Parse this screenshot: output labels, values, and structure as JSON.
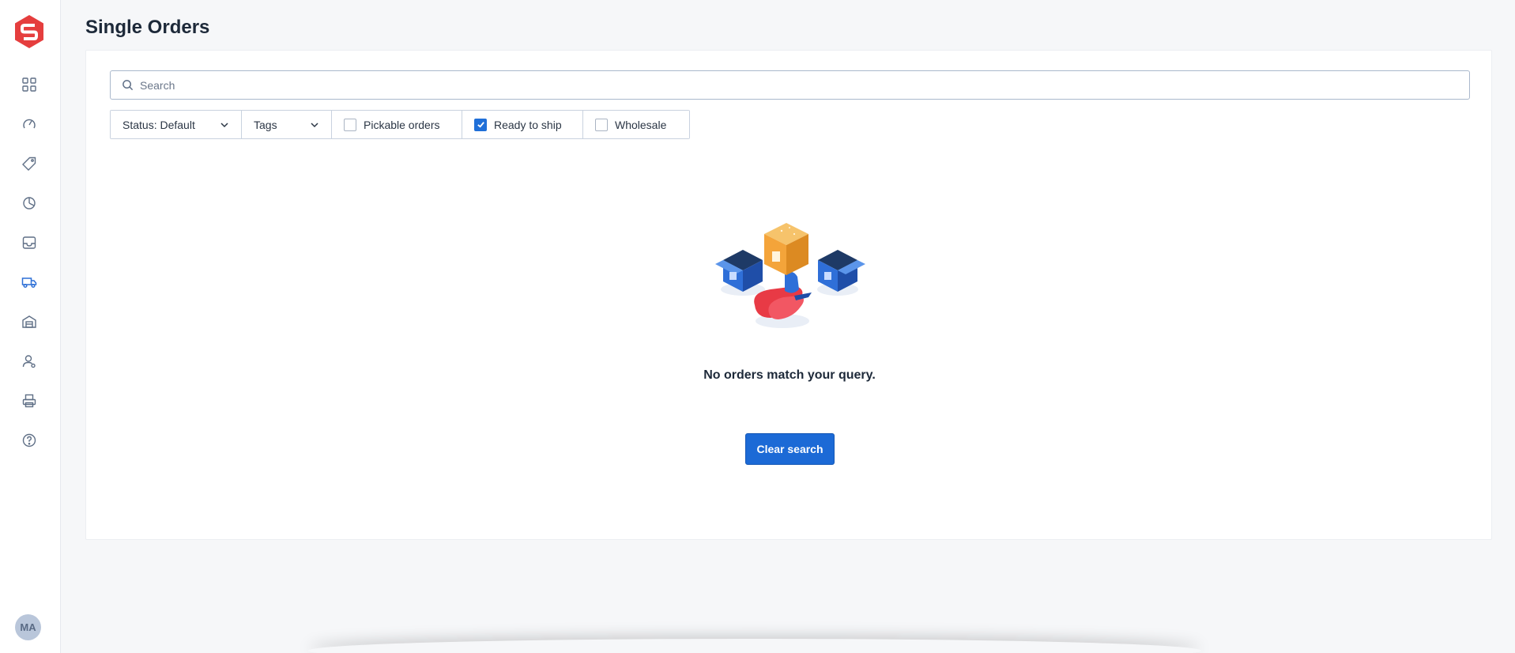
{
  "page": {
    "title": "Single Orders"
  },
  "sidebar": {
    "logo": "shipstation-s-logo",
    "brand_color": "#e53e3e",
    "items": [
      {
        "icon": "dashboard-grid-icon"
      },
      {
        "icon": "speedometer-icon"
      },
      {
        "icon": "tag-icon"
      },
      {
        "icon": "pie-chart-icon"
      },
      {
        "icon": "inbox-icon"
      },
      {
        "icon": "truck-icon",
        "active": true
      },
      {
        "icon": "warehouse-icon"
      },
      {
        "icon": "customers-icon"
      },
      {
        "icon": "printer-icon"
      },
      {
        "icon": "help-icon"
      }
    ],
    "avatar_initials": "MA"
  },
  "search": {
    "placeholder": "Search",
    "value": ""
  },
  "filters": {
    "status": {
      "label": "Status: Default"
    },
    "tags": {
      "label": "Tags"
    },
    "pickable": {
      "label": "Pickable orders",
      "checked": false
    },
    "ready_to_ship": {
      "label": "Ready to ship",
      "checked": true
    },
    "wholesale": {
      "label": "Wholesale",
      "checked": false
    }
  },
  "empty_state": {
    "message": "No orders match your query.",
    "button_label": "Clear search",
    "illustration": "shipping-boxes-illustration"
  },
  "colors": {
    "accent": "#1c6ad6",
    "checkbox_checked": "#1f6fd8"
  }
}
